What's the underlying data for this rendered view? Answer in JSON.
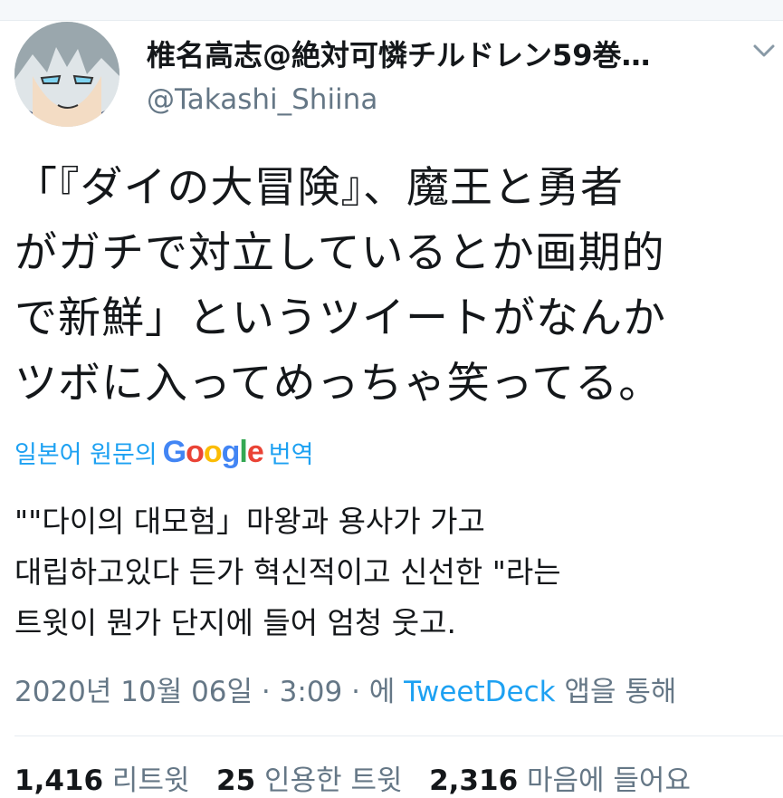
{
  "user": {
    "display_name": "椎名高志@絶対可憐チルドレン59巻…",
    "handle": "@Takashi_Shiina"
  },
  "tweet": {
    "lines": [
      "「『ダイの大冒険』、魔王と勇者",
      "がガチで対立しているとか画期的",
      "で新鮮」というツイートがなんか",
      "ツボに入ってめっちゃ笑ってる。"
    ]
  },
  "translation": {
    "prefix": "일본어 원문의",
    "google": "Google",
    "suffix": "번역",
    "lines": [
      "\"\"다이의 대모험」마왕과 용사가 가고",
      "대립하고있다 든가 혁신적이고 신선한 \"라는",
      "트윗이 뭔가 단지에 들어 엄청 웃고."
    ]
  },
  "meta": {
    "timestamp": "2020년 10월 06일 · 3:09 · 에",
    "source": "TweetDeck",
    "suffix": "앱을 통해"
  },
  "stats": {
    "retweets": "1,416",
    "retweets_label": "리트윗",
    "quotes": "25",
    "quotes_label": "인용한 트윗",
    "likes": "2,316",
    "likes_label": "마음에 들어요"
  },
  "colors": {
    "accent": "#1da1f2",
    "muted": "#657786",
    "text": "#14171a"
  }
}
